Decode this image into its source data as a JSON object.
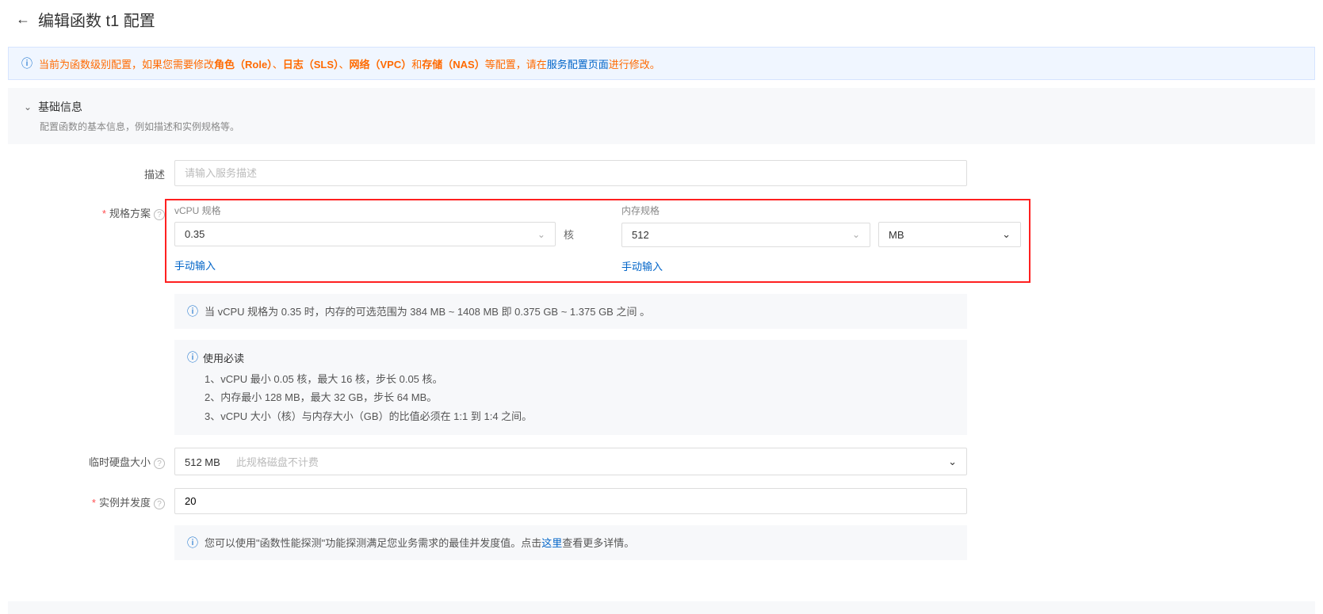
{
  "header": {
    "title": "编辑函数 t1 配置"
  },
  "alert": {
    "prefix": "当前为函数级别配置，如果您需要修改",
    "bold1": "角色（Role）",
    "sep1": "、",
    "bold2": "日志（SLS）",
    "sep2": "、",
    "bold3": "网络（VPC）",
    "sep3": "和",
    "bold4": "存储（NAS）",
    "mid": "等配置，请在",
    "link": "服务配置页面",
    "suffix": "进行修改。"
  },
  "section": {
    "title": "基础信息",
    "desc": "配置函数的基本信息，例如描述和实例规格等。"
  },
  "form": {
    "desc_label": "描述",
    "desc_placeholder": "请输入服务描述",
    "spec_label": "规格方案",
    "vcpu_label": "vCPU 规格",
    "vcpu_value": "0.35",
    "vcpu_unit": "核",
    "mem_label": "内存规格",
    "mem_value": "512",
    "mem_unit": "MB",
    "manual_input": "手动输入",
    "range_info": "当 vCPU 规格为 0.35 时，内存的可选范围为 384 MB ~ 1408 MB 即 0.375 GB ~ 1.375 GB 之间 。",
    "usage_title": "使用必读",
    "usage_1": "1、vCPU 最小 0.05 核，最大 16 核，步长 0.05 核。",
    "usage_2": "2、内存最小 128 MB，最大 32 GB，步长 64 MB。",
    "usage_3": "3、vCPU 大小（核）与内存大小（GB）的比值必须在 1:1 到 1:4 之间。",
    "disk_label": "临时硬盘大小",
    "disk_value": "512 MB",
    "disk_hint": "此规格磁盘不计费",
    "concurrency_label": "实例并发度",
    "concurrency_value": "20",
    "perf_info_prefix": "您可以使用\"函数性能探测\"功能探测满足您业务需求的最佳并发度值。点击",
    "perf_info_link": "这里",
    "perf_info_suffix": "查看更多详情。"
  }
}
